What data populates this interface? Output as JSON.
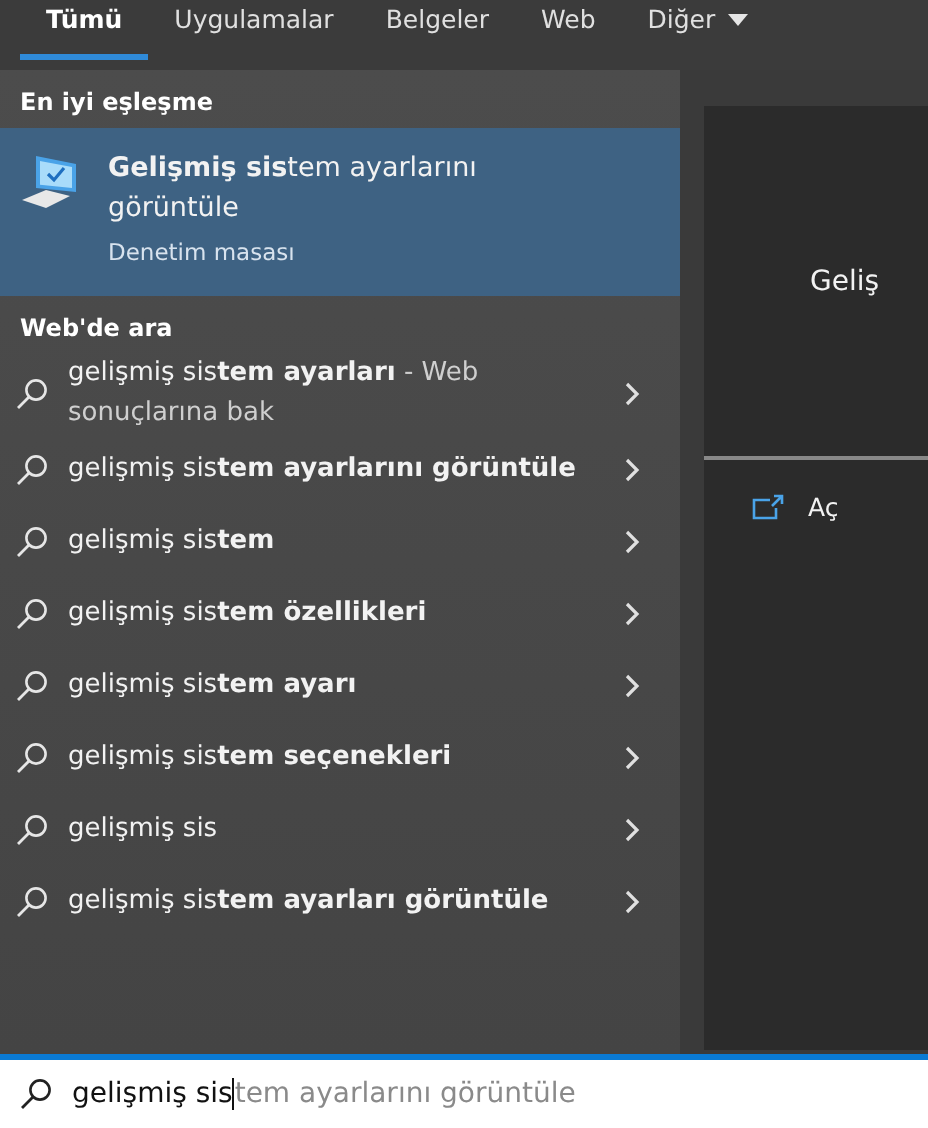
{
  "tabs": [
    {
      "label": "Tümü",
      "selected": true
    },
    {
      "label": "Uygulamalar",
      "selected": false
    },
    {
      "label": "Belgeler",
      "selected": false
    },
    {
      "label": "Web",
      "selected": false
    },
    {
      "label": "Diğer",
      "selected": false,
      "dropdown": true
    }
  ],
  "best_match": {
    "heading": "En iyi eşleşme",
    "title": "**Gelişmiş sis**tem ayarlarını görüntüle",
    "subtitle": "Denetim masası",
    "selected": true
  },
  "web": {
    "heading": "Web'de ara",
    "items": [
      {
        "text": "gelişmiş sis**tem ayarları**",
        "note": " - Web sonuçlarına bak"
      },
      {
        "text": "gelişmiş sis**tem ayarlarını görüntüle**"
      },
      {
        "text": "gelişmiş sis**tem**"
      },
      {
        "text": "gelişmiş sis**tem özellikleri**"
      },
      {
        "text": "gelişmiş sis**tem ayarı**"
      },
      {
        "text": "gelişmiş sis**tem seçenekleri**"
      },
      {
        "text": "gelişmiş sis"
      },
      {
        "text": "gelişmiş sis**tem ayarları görüntüle**"
      }
    ]
  },
  "preview": {
    "title": "Geliş",
    "actions": [
      {
        "label": "Aç"
      }
    ]
  },
  "search": {
    "value": "gelişmiş sis",
    "suggestion": "tem ayarlarını görüntüle"
  }
}
